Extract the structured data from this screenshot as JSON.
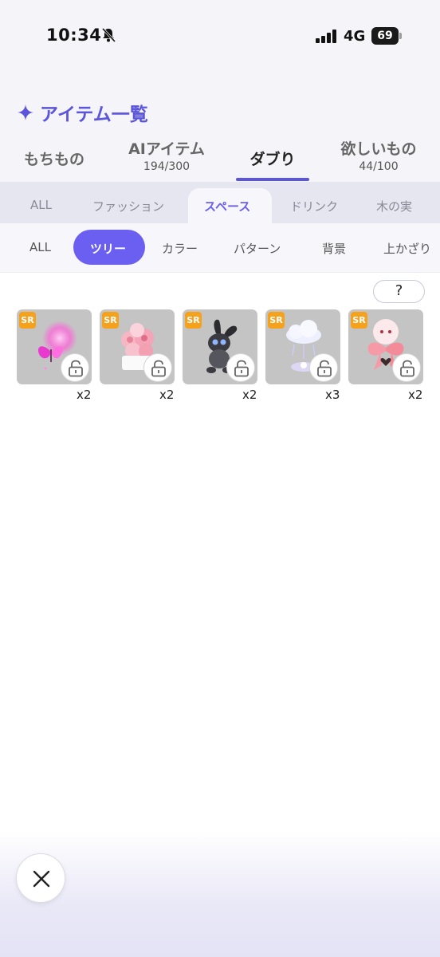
{
  "status": {
    "time": "10:34",
    "network": "4G",
    "battery": "69"
  },
  "header": {
    "title": "アイテム一覧"
  },
  "main_tabs": [
    {
      "label": "もちもの",
      "sub": ""
    },
    {
      "label": "AIアイテム",
      "sub": "194/300"
    },
    {
      "label": "ダブり",
      "sub": "",
      "active": true
    },
    {
      "label": "欲しいもの",
      "sub": "44/100"
    }
  ],
  "category_tabs": [
    "ALL",
    "ファッション",
    "スペース",
    "ドリンク",
    "木の実"
  ],
  "category_active": "スペース",
  "sub_tabs": [
    "ALL",
    "ツリー",
    "カラー",
    "パターン",
    "背景",
    "上かざり"
  ],
  "sub_active": "ツリー",
  "help": {
    "label": "?"
  },
  "items": [
    {
      "rarity": "SR",
      "count": "x2",
      "art": "pink-butterfly",
      "locked": true
    },
    {
      "rarity": "SR",
      "count": "x2",
      "art": "pink-rose-bouquet",
      "locked": true
    },
    {
      "rarity": "SR",
      "count": "x2",
      "art": "black-bunny-plush",
      "locked": true
    },
    {
      "rarity": "SR",
      "count": "x3",
      "art": "rain-cloud",
      "locked": true
    },
    {
      "rarity": "SR",
      "count": "x2",
      "art": "pink-ribbon-heart",
      "locked": true
    }
  ],
  "colors": {
    "accent": "#6a5ff0",
    "title": "#5b55dc",
    "rarity": "#f5a11b"
  },
  "icons": [
    "bell-slash-icon",
    "signal-icon",
    "sparkle-icon",
    "lock-icon",
    "close-icon"
  ]
}
